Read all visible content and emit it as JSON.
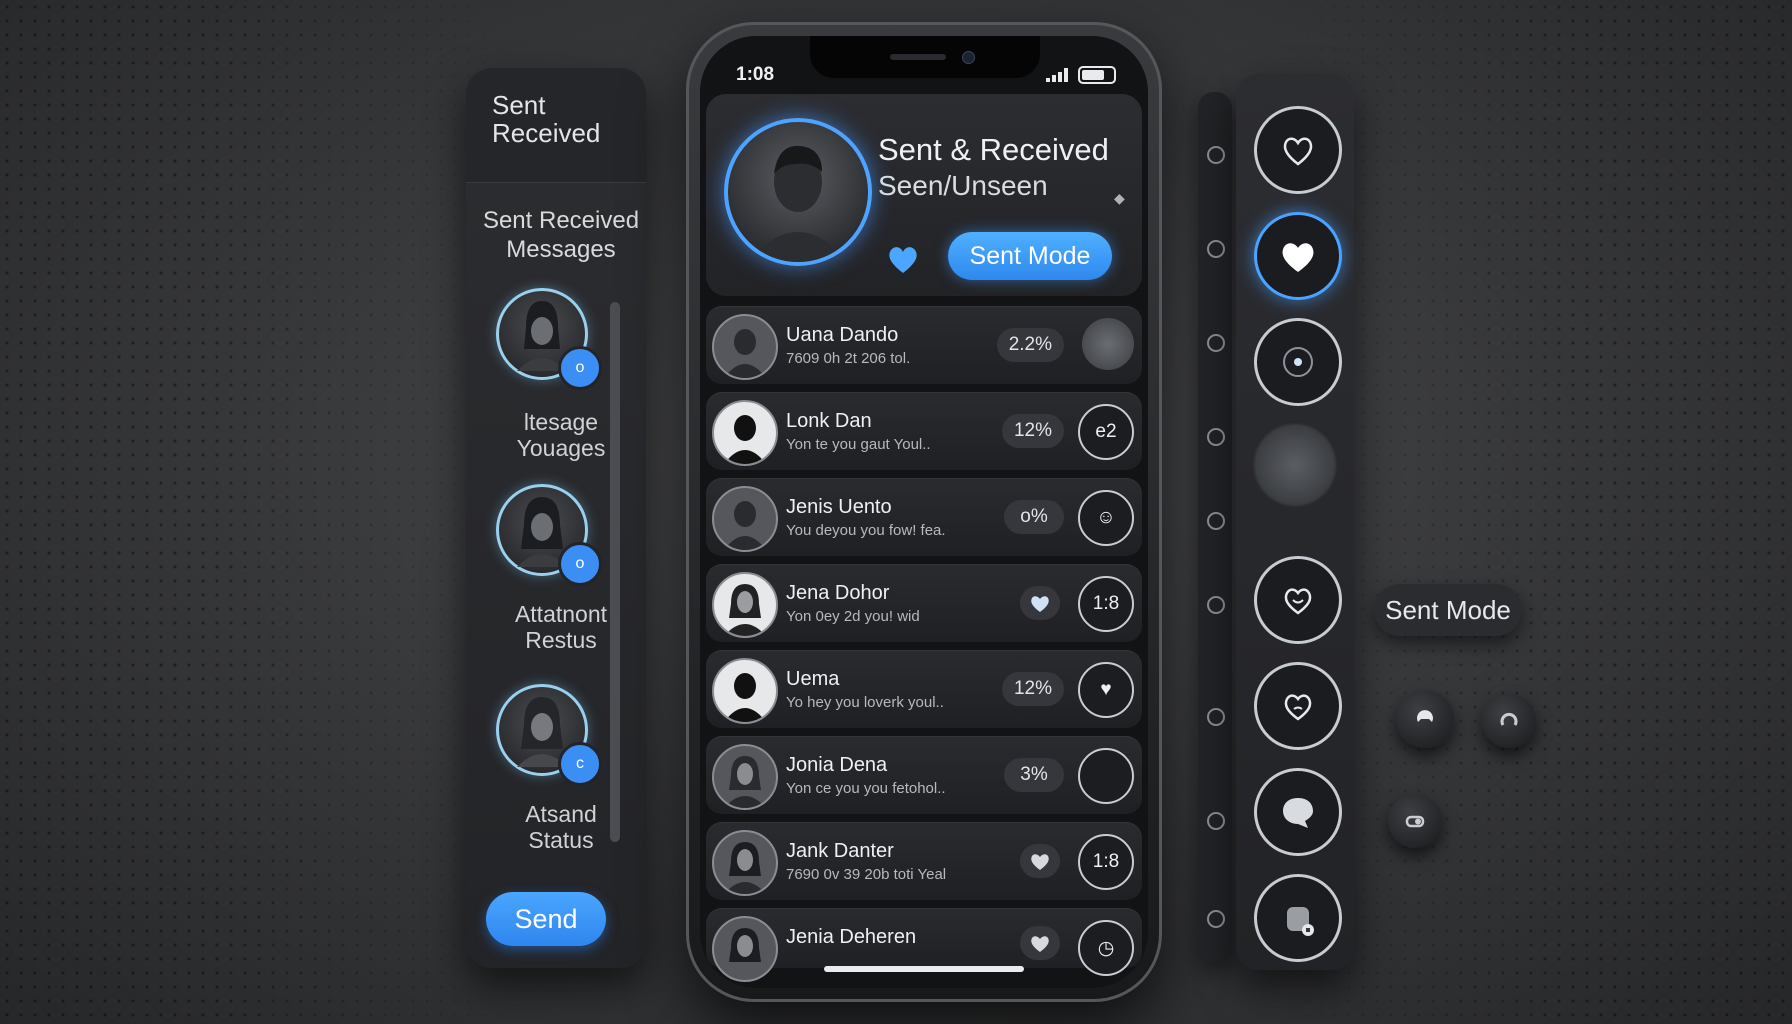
{
  "left_panel": {
    "header_line1": "Sent",
    "header_line2": "Received",
    "subtitle_line1": "Sent Received",
    "subtitle_line2": "Messages",
    "items": [
      {
        "caption_line1": "ltesage",
        "caption_line2": "Youages",
        "badge": "o"
      },
      {
        "caption_line1": "Attatnont",
        "caption_line2": "Restus",
        "badge": "o"
      },
      {
        "caption_line1": "Atsand",
        "caption_line2": "Status",
        "badge": "c"
      }
    ],
    "send_label": "Send"
  },
  "phone": {
    "time": "1:08",
    "header": {
      "title": "Sent & Received",
      "subtitle": "Seen/Unseen",
      "mode_button": "Sent Mode"
    },
    "contacts": [
      {
        "name": "Uana Dando",
        "message": "7609 0h 2t 206 tol.",
        "badge": "2.2%",
        "action": "",
        "avatar": "dark"
      },
      {
        "name": "Lonk Dan",
        "message": "Yon te you gaut Youl..",
        "badge": "12%",
        "action": "e2",
        "avatar": "light"
      },
      {
        "name": "Jenis Uento",
        "message": "You deyou you fow! fea.",
        "badge": "o%",
        "action": "☺",
        "avatar": "dark"
      },
      {
        "name": "Jena Dohor",
        "message": "Yon 0ey 2d you! wid",
        "badge": "",
        "action": "1:8",
        "avatar": "light"
      },
      {
        "name": "Uema",
        "message": "Yo hey you loverk youl..",
        "badge": "12%",
        "action": "♥",
        "avatar": "light"
      },
      {
        "name": "Jonia Dena",
        "message": "Yon ce you you fetohol..",
        "badge": "3%",
        "action": "",
        "avatar": "dark"
      },
      {
        "name": "Jank Danter",
        "message": "7690 0v 39 20b toti Yeal",
        "badge": "",
        "action": "1:8",
        "avatar": "dark"
      },
      {
        "name": "Jenia Deheren",
        "message": "",
        "badge": "",
        "action": "◷",
        "avatar": "dark"
      }
    ]
  },
  "right_panel": {
    "icons": [
      "heart-outline-icon",
      "heart-filled-icon",
      "record-icon",
      "blurred-avatar-icon",
      "heart-smile-icon",
      "heart-face-icon",
      "chat-bubble-icon",
      "profile-lock-icon"
    ],
    "chip_label": "Sent Mode"
  },
  "colors": {
    "accent": "#3b8ef3",
    "background": "#353638",
    "panel": "#242528"
  }
}
